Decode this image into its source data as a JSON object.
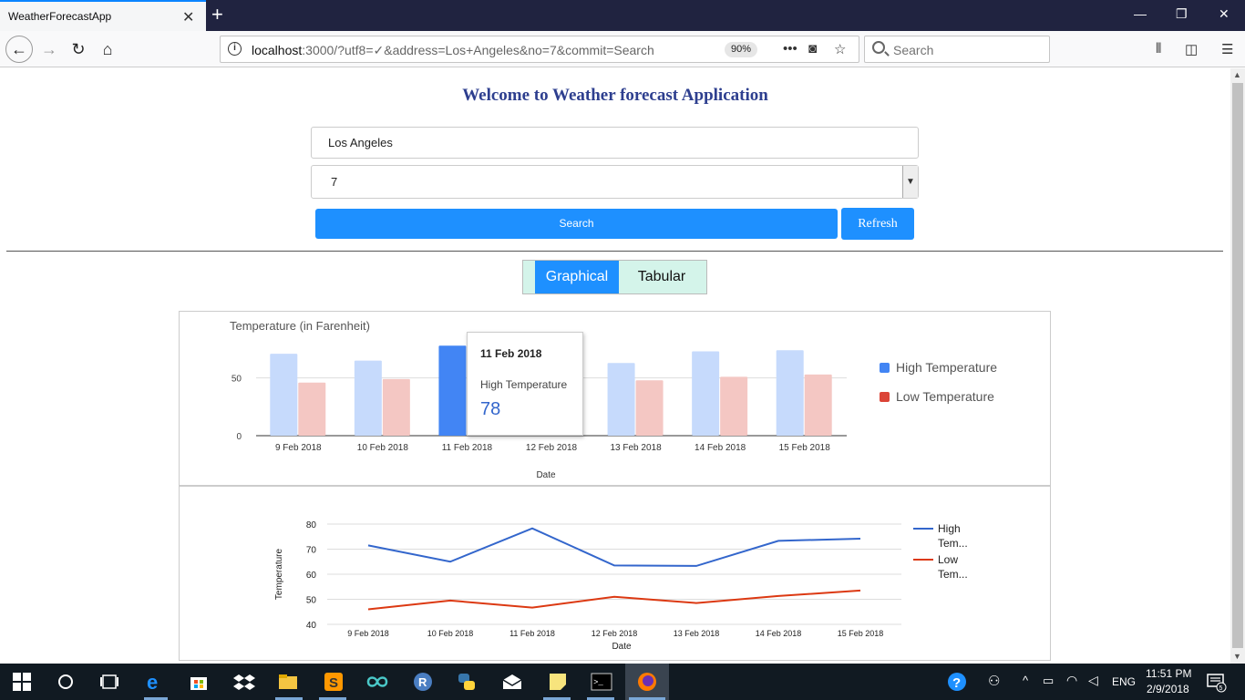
{
  "browser": {
    "tab_title": "WeatherForecastApp",
    "url_host": "localhost",
    "url_rest": ":3000/?utf8=✓&address=Los+Angeles&no=7&commit=Search",
    "zoom": "90%",
    "search_placeholder": "Search"
  },
  "app": {
    "title": "Welcome to Weather forecast Application",
    "address_value": "Los Angeles",
    "days_value": "7",
    "search_label": "Search",
    "refresh_label": "Refresh",
    "tabs": [
      {
        "label": "Graphical",
        "active": true
      },
      {
        "label": "Tabular",
        "active": false
      }
    ]
  },
  "tooltip": {
    "date": "11 Feb 2018",
    "label": "High Temperature",
    "value": "78"
  },
  "chart_data": [
    {
      "type": "bar",
      "title": "Temperature (in Farenheit)",
      "xlabel": "Date",
      "ylabel": "",
      "ylim": [
        0,
        90
      ],
      "yticks": [
        0,
        50
      ],
      "categories": [
        "9 Feb 2018",
        "10 Feb 2018",
        "11 Feb 2018",
        "12 Feb 2018",
        "13 Feb 2018",
        "14 Feb 2018",
        "15 Feb 2018"
      ],
      "legend_position": "right",
      "highlighted_index": 2,
      "series": [
        {
          "name": "High Temperature",
          "color": "#4285f4",
          "values": [
            71,
            65,
            78,
            64,
            63,
            73,
            74
          ]
        },
        {
          "name": "Low Temperature",
          "color": "#db4437",
          "values": [
            46,
            49,
            46,
            51,
            48,
            51,
            53
          ]
        }
      ]
    },
    {
      "type": "line",
      "title": "",
      "xlabel": "Date",
      "ylabel": "Temperature",
      "ylim": [
        40,
        80
      ],
      "yticks": [
        40,
        50,
        60,
        70,
        80
      ],
      "grid": true,
      "categories": [
        "9 Feb 2018",
        "10 Feb 2018",
        "11 Feb 2018",
        "12 Feb 2018",
        "13 Feb 2018",
        "14 Feb 2018",
        "15 Feb 2018"
      ],
      "legend_position": "right",
      "series": [
        {
          "name": "High Tem...",
          "color": "#3366cc",
          "values": [
            71.5,
            65,
            78.3,
            63.5,
            63.3,
            73.3,
            74.2
          ]
        },
        {
          "name": "Low Tem...",
          "color": "#dc3912",
          "values": [
            46,
            49.5,
            46.7,
            51,
            48.5,
            51.3,
            53.5
          ]
        }
      ]
    }
  ],
  "taskbar": {
    "time": "11:51 PM",
    "date": "2/9/2018",
    "language": "ENG",
    "notifications": "5"
  },
  "colors": {
    "accent": "#1e90ff",
    "title": "#2e3f8f",
    "tab_bg": "#d4f4ea"
  }
}
